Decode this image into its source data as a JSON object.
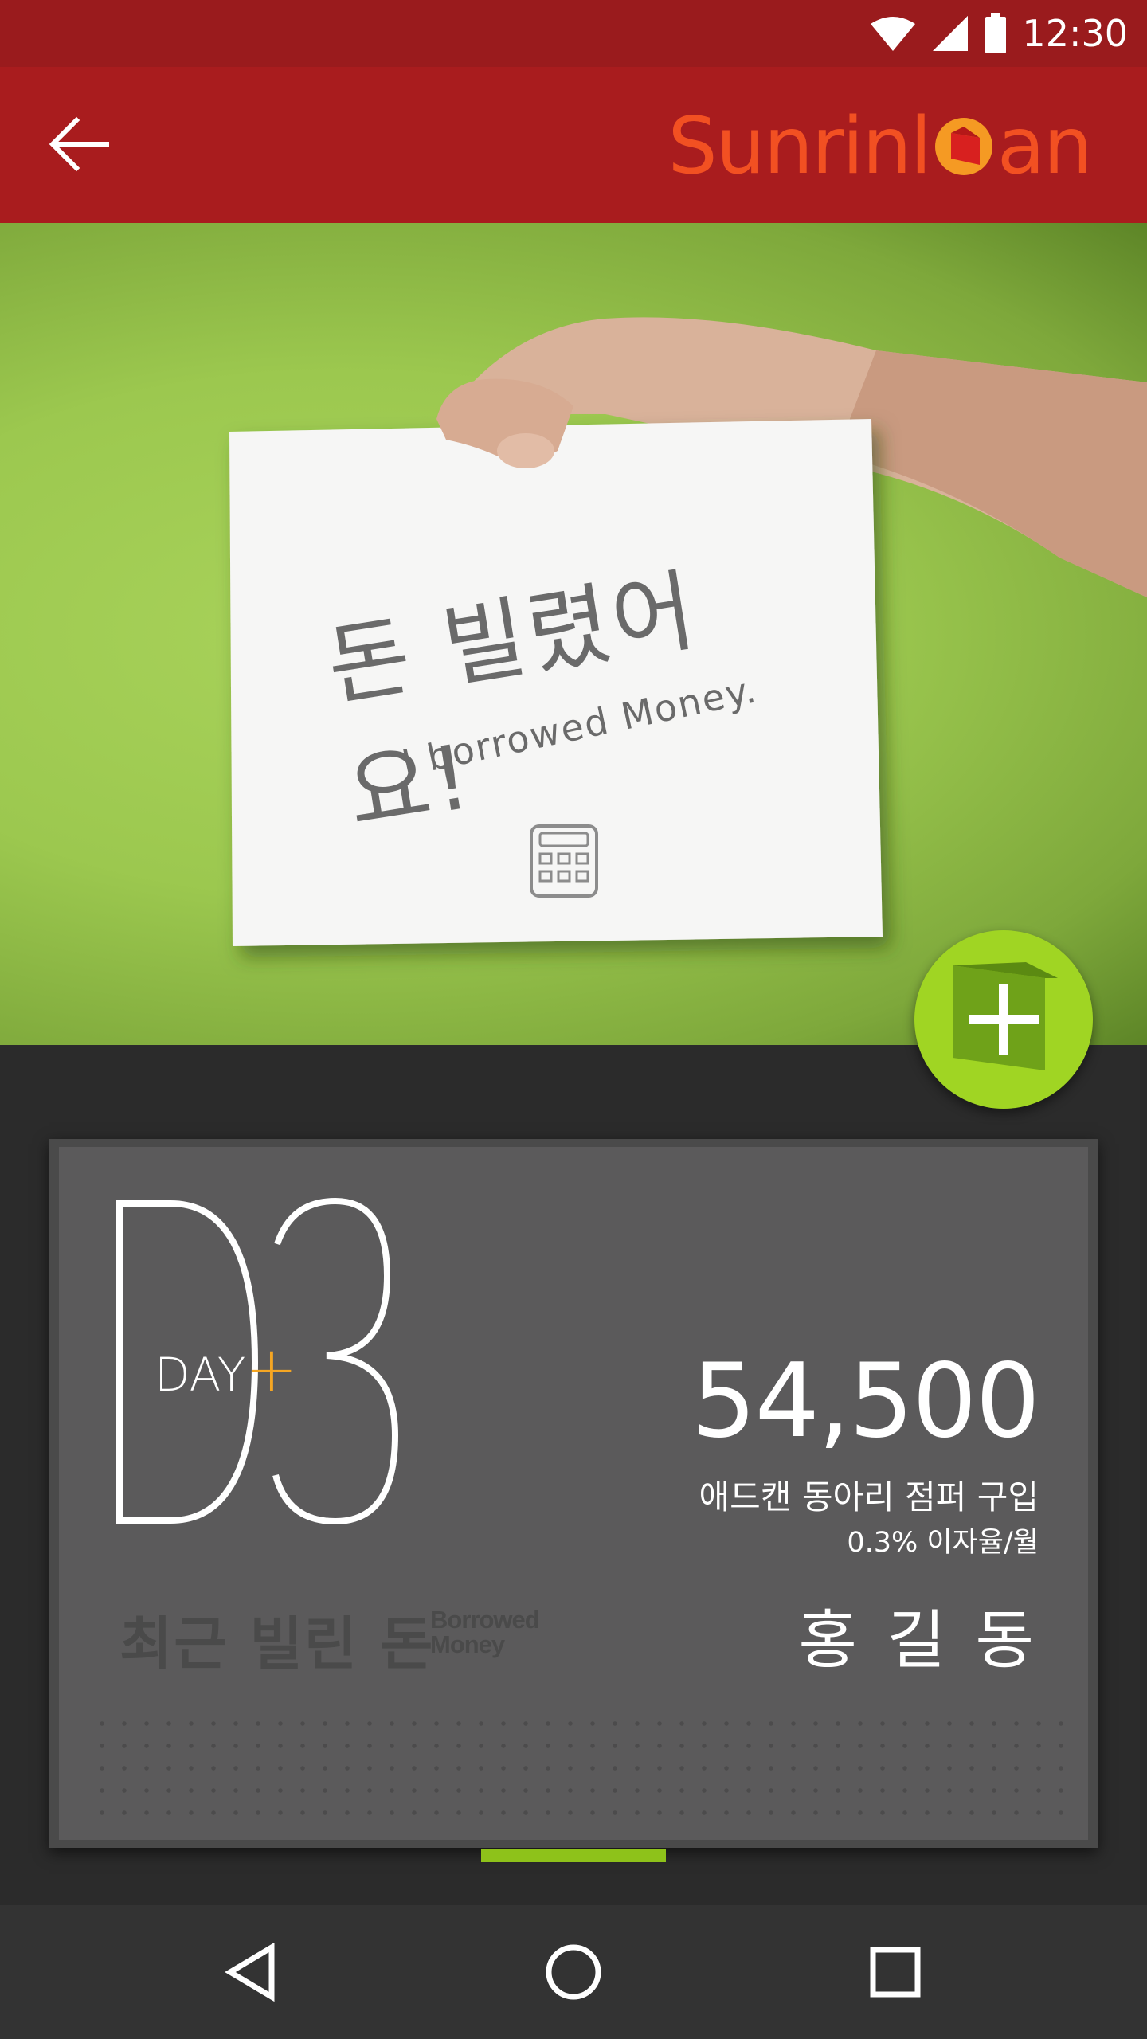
{
  "status_bar": {
    "time": "12:30",
    "icons": [
      "wifi-icon",
      "signal-icon",
      "battery-icon"
    ]
  },
  "app_bar": {
    "back_icon": "arrow-left-icon",
    "logo_text_left": "Sunrinl",
    "logo_text_right": "an",
    "logo_color": "#f25022"
  },
  "hero": {
    "note_korean": "돈 빌렸어요!",
    "note_english": "I borrowed Money.",
    "note_icon": "calculator-icon"
  },
  "fab": {
    "icon": "add-icon",
    "color": "#a0d523"
  },
  "card": {
    "day_label": "DAY",
    "day_sign": "+",
    "big_letter": "D",
    "big_number": "3",
    "amount": "54,500",
    "item_title": "애드캔 동아리 점퍼 구입",
    "rate": "0.3% 이자율/월",
    "recent_label": "최근 빌린 돈",
    "recent_sub_1": "Borrowed",
    "recent_sub_2": "Money",
    "person_name": "홍 길 동"
  },
  "pager": {
    "active_color": "#8ec21a"
  },
  "nav_bar": {
    "icons": [
      "back-triangle-icon",
      "home-circle-icon",
      "recents-square-icon"
    ]
  }
}
